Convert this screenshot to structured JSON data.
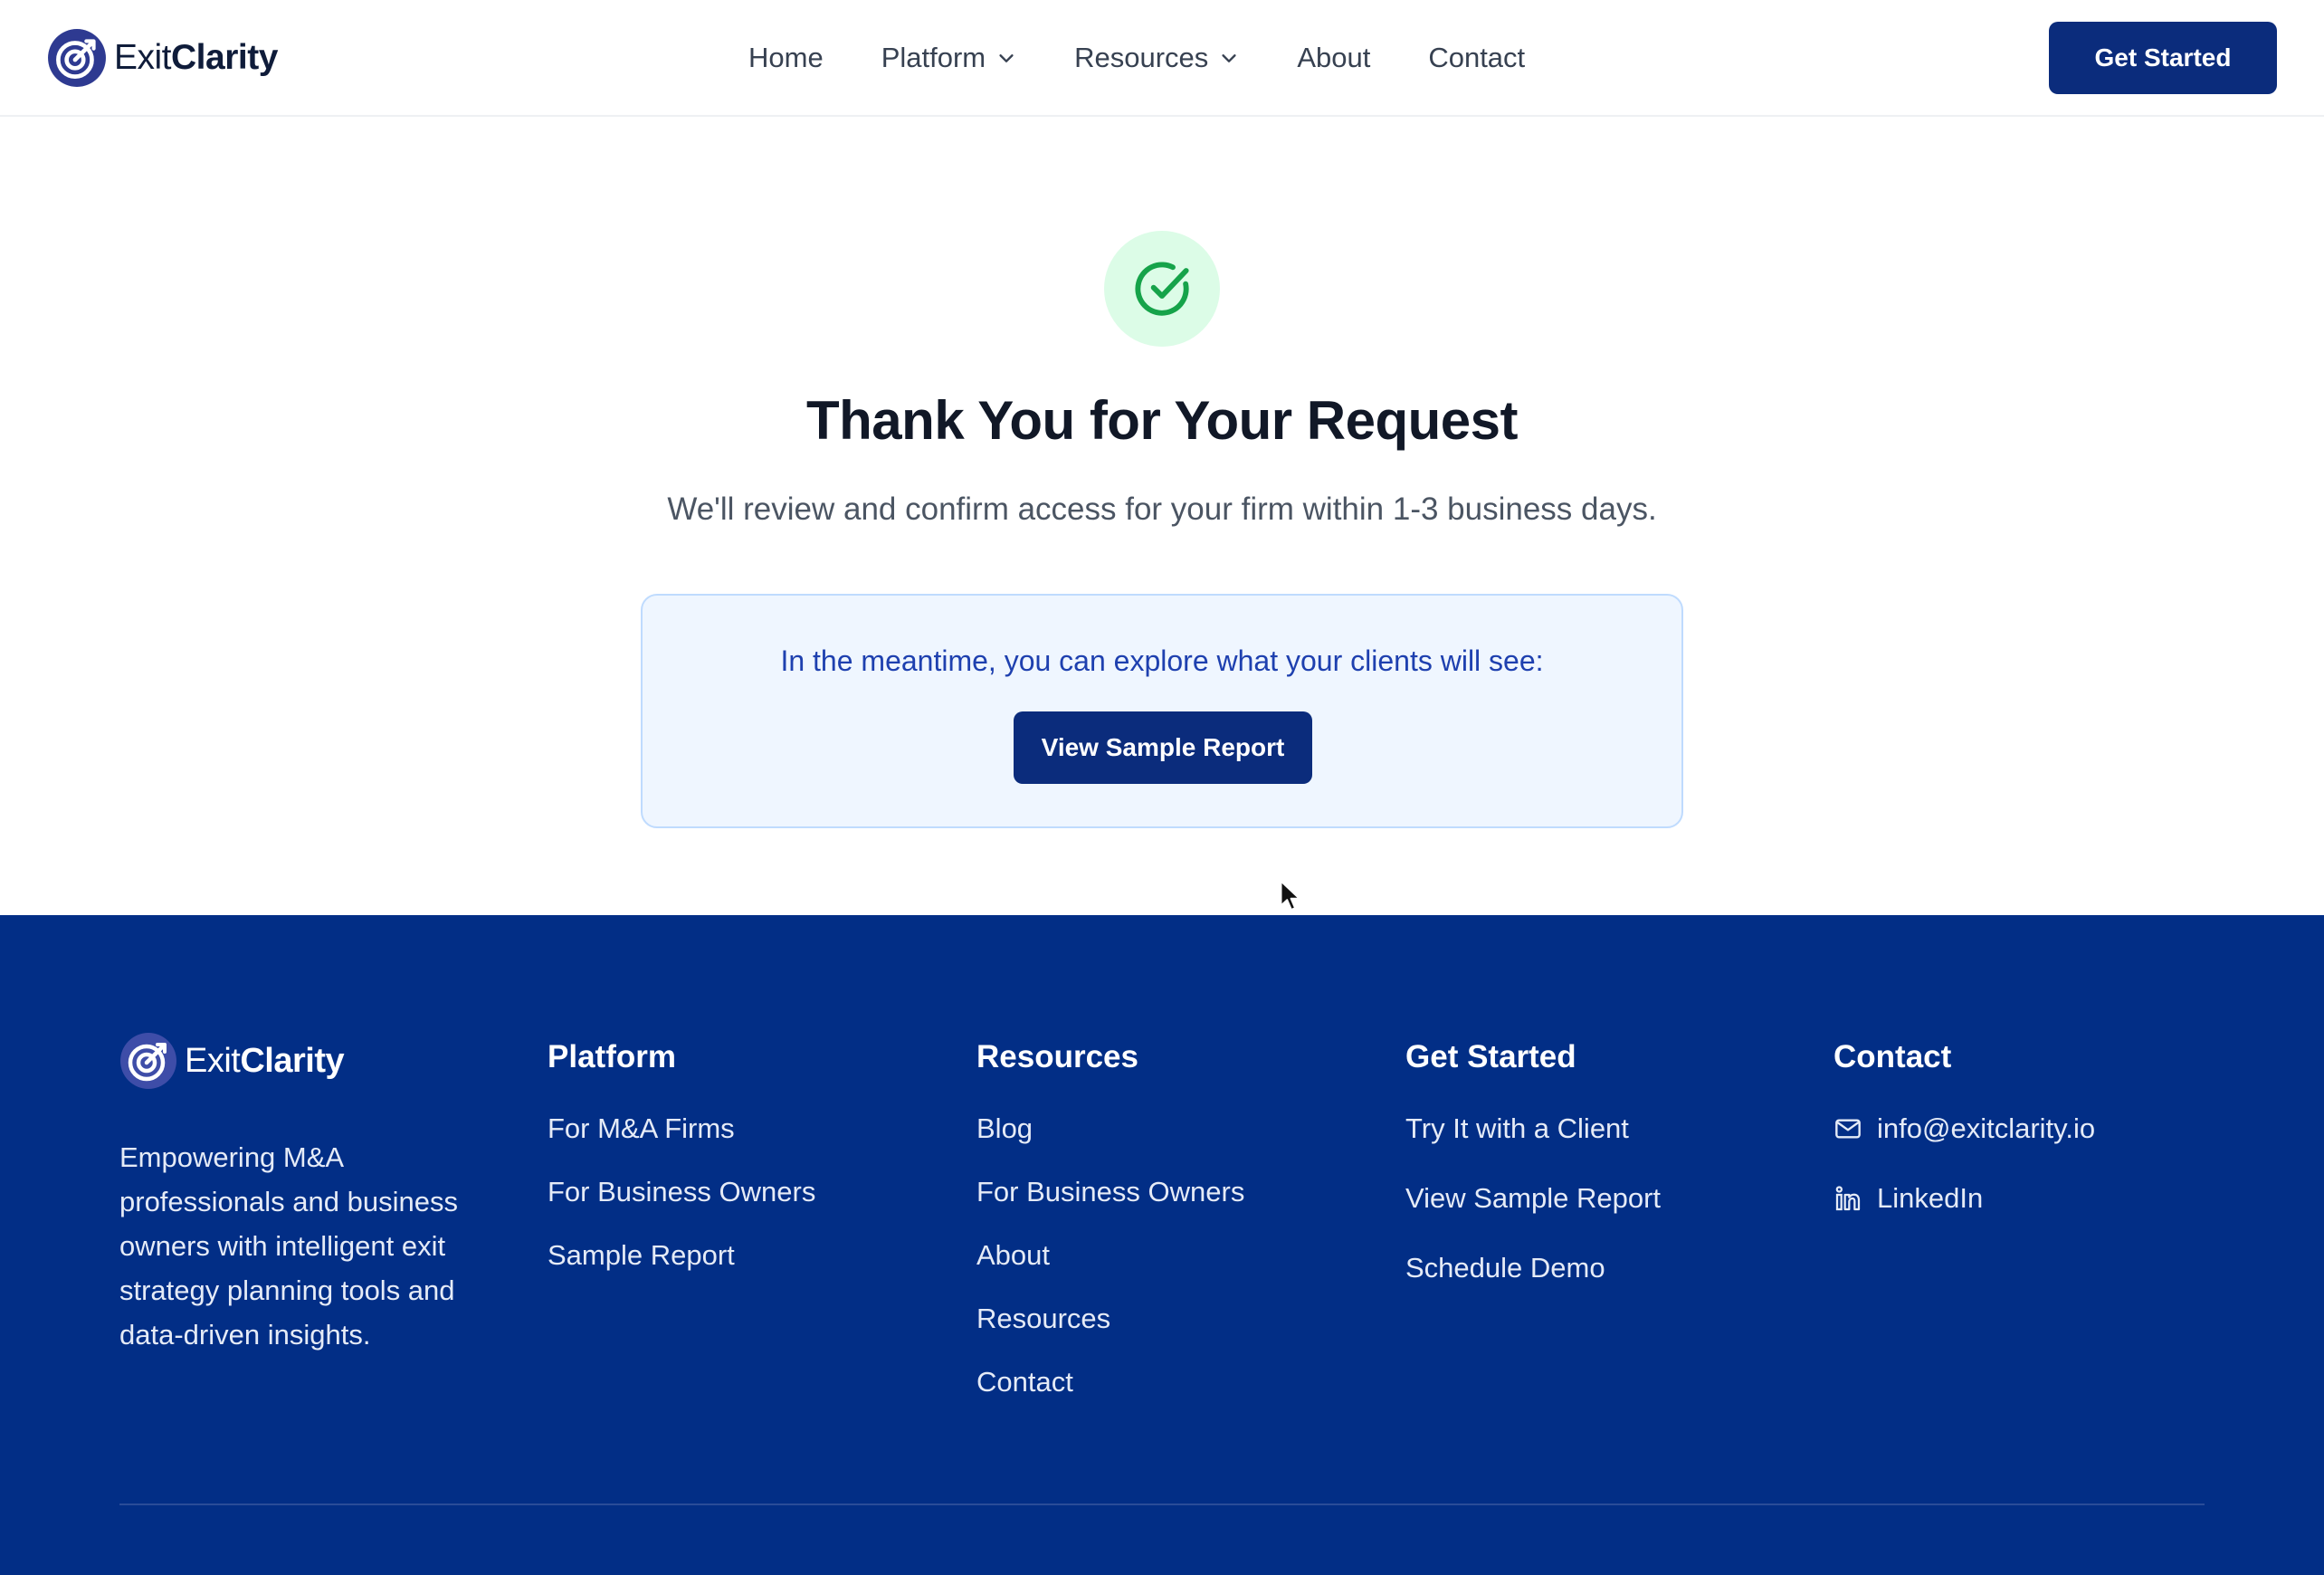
{
  "header": {
    "brand": {
      "prefix": "Exit",
      "suffix": "Clarity"
    },
    "nav": [
      {
        "label": "Home",
        "dropdown": false
      },
      {
        "label": "Platform",
        "dropdown": true
      },
      {
        "label": "Resources",
        "dropdown": true
      },
      {
        "label": "About",
        "dropdown": false
      },
      {
        "label": "Contact",
        "dropdown": false
      }
    ],
    "cta_label": "Get Started"
  },
  "hero": {
    "icon": "check-circle-icon",
    "title": "Thank You for Your Request",
    "subtitle": "We'll review and confirm access for your firm within 1-3 business days.",
    "info_text": "In the meantime, you can explore what your clients will see:",
    "info_button": "View Sample Report"
  },
  "footer": {
    "brand": {
      "prefix": "Exit",
      "suffix": "Clarity"
    },
    "description": "Empowering M&A professionals and business owners with intelligent exit strategy planning tools and data-driven insights.",
    "columns": [
      {
        "heading": "Platform",
        "links": [
          "For M&A Firms",
          "For Business Owners",
          "Sample Report"
        ]
      },
      {
        "heading": "Resources",
        "links": [
          "Blog",
          "For Business Owners",
          "About",
          "Resources",
          "Contact"
        ]
      },
      {
        "heading": "Get Started",
        "links": [
          "Try It with a Client",
          "View Sample Report",
          "Schedule Demo"
        ]
      }
    ],
    "contact": {
      "heading": "Contact",
      "email": "info@exitclarity.io",
      "linkedin": "LinkedIn"
    }
  },
  "colors": {
    "brand_navy": "#0b2c7c",
    "footer_bg": "#022e86",
    "success_green": "#16a34a",
    "success_bg": "#dcfce7",
    "info_bg": "#eff6ff",
    "info_text": "#1e40af"
  }
}
